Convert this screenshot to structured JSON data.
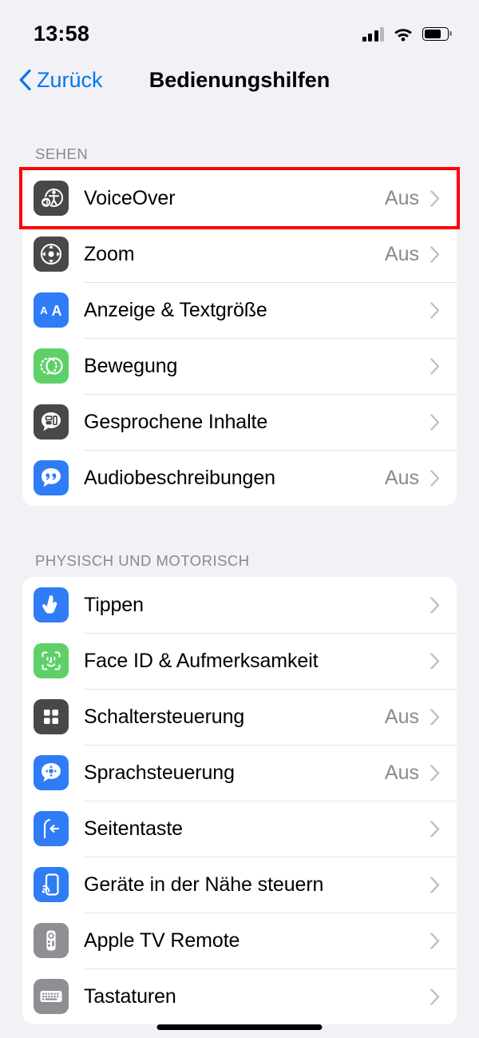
{
  "status_bar": {
    "time": "13:58",
    "signal_icon": "cellular-signal-icon",
    "wifi_icon": "wifi-icon",
    "battery_icon": "battery-icon",
    "battery_level_percent": 75
  },
  "nav": {
    "back_label": "Zurück",
    "back_icon": "chevron-left-icon",
    "title": "Bedienungshilfen"
  },
  "colors": {
    "accent_blue": "#0a74f0",
    "highlight_red": "#ff0000",
    "page_background": "#f1f1f6",
    "card_background": "#ffffff",
    "secondary_text": "#8a8a8e",
    "icon_dark": "#48484a",
    "icon_blue": "#2f7cf6",
    "icon_green": "#5fd068",
    "icon_gray": "#8e8e93"
  },
  "sections": [
    {
      "header": "SEHEN",
      "rows": [
        {
          "label": "VoiceOver",
          "value": "Aus",
          "icon": "voiceover-icon",
          "icon_color": "#48484a",
          "highlighted": true
        },
        {
          "label": "Zoom",
          "value": "Aus",
          "icon": "zoom-icon",
          "icon_color": "#48484a",
          "highlighted": false
        },
        {
          "label": "Anzeige & Textgröße",
          "value": "",
          "icon": "display-text-size-icon",
          "icon_color": "#2f7cf6",
          "highlighted": false
        },
        {
          "label": "Bewegung",
          "value": "",
          "icon": "motion-icon",
          "icon_color": "#5fd068",
          "highlighted": false
        },
        {
          "label": "Gesprochene Inhalte",
          "value": "",
          "icon": "spoken-content-icon",
          "icon_color": "#48484a",
          "highlighted": false
        },
        {
          "label": "Audiobeschreibungen",
          "value": "Aus",
          "icon": "audio-descriptions-icon",
          "icon_color": "#2f7cf6",
          "highlighted": false
        }
      ]
    },
    {
      "header": "PHYSISCH UND MOTORISCH",
      "rows": [
        {
          "label": "Tippen",
          "value": "",
          "icon": "touch-icon",
          "icon_color": "#2f7cf6",
          "highlighted": false
        },
        {
          "label": "Face ID & Aufmerksamkeit",
          "value": "",
          "icon": "face-id-icon",
          "icon_color": "#5fd068",
          "highlighted": false
        },
        {
          "label": "Schaltersteuerung",
          "value": "Aus",
          "icon": "switch-control-icon",
          "icon_color": "#48484a",
          "highlighted": false
        },
        {
          "label": "Sprachsteuerung",
          "value": "Aus",
          "icon": "voice-control-icon",
          "icon_color": "#2f7cf6",
          "highlighted": false
        },
        {
          "label": "Seitentaste",
          "value": "",
          "icon": "side-button-icon",
          "icon_color": "#2f7cf6",
          "highlighted": false
        },
        {
          "label": "Geräte in der Nähe steuern",
          "value": "",
          "icon": "control-nearby-devices-icon",
          "icon_color": "#2f7cf6",
          "highlighted": false
        },
        {
          "label": "Apple TV Remote",
          "value": "",
          "icon": "apple-tv-remote-icon",
          "icon_color": "#8e8e93",
          "highlighted": false
        },
        {
          "label": "Tastaturen",
          "value": "",
          "icon": "keyboards-icon",
          "icon_color": "#8e8e93",
          "highlighted": false
        }
      ]
    }
  ],
  "home_indicator": "home-indicator"
}
